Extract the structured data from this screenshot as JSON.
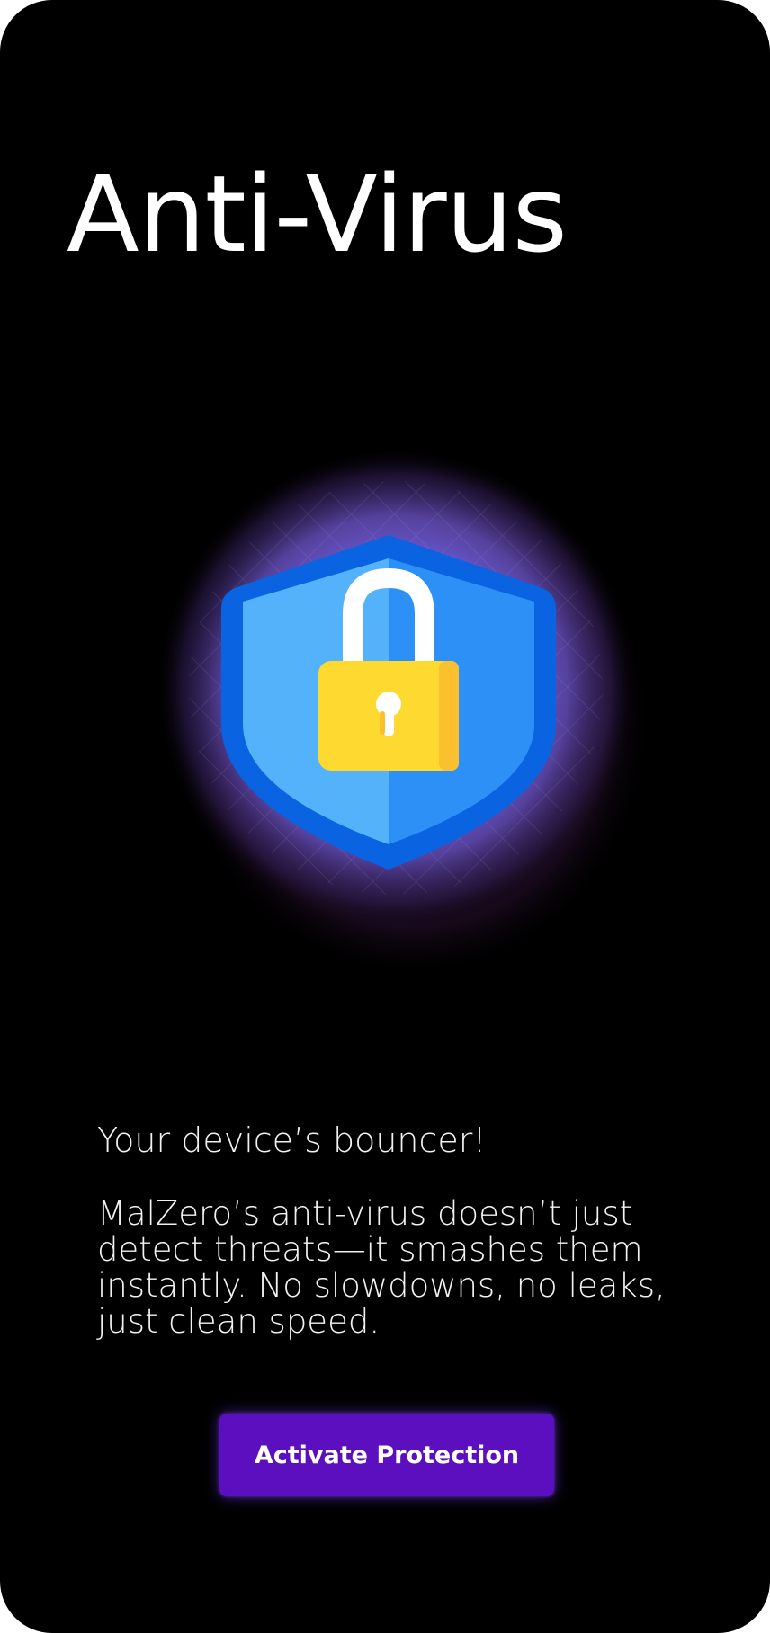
{
  "screen": {
    "title": "Anti-Virus",
    "tagline": "Your device’s bouncer!",
    "description": "MalZero’s anti-virus doesn’t just detect threats—it smashes them instantly. No slowdowns, no leaks, just clean speed.",
    "cta_label": "Activate Protection"
  },
  "illustration": {
    "icon": "shield-lock-icon",
    "glow_color": "#7a6cff"
  },
  "colors": {
    "background": "#000000",
    "text": "#ffffff",
    "button": "#5b0fbf",
    "shield_outer": "#0a63e0",
    "shield_left": "#54b2fb",
    "shield_right": "#2d90f7",
    "lock_body": "#fed930",
    "lock_shackle": "#ffffff"
  }
}
